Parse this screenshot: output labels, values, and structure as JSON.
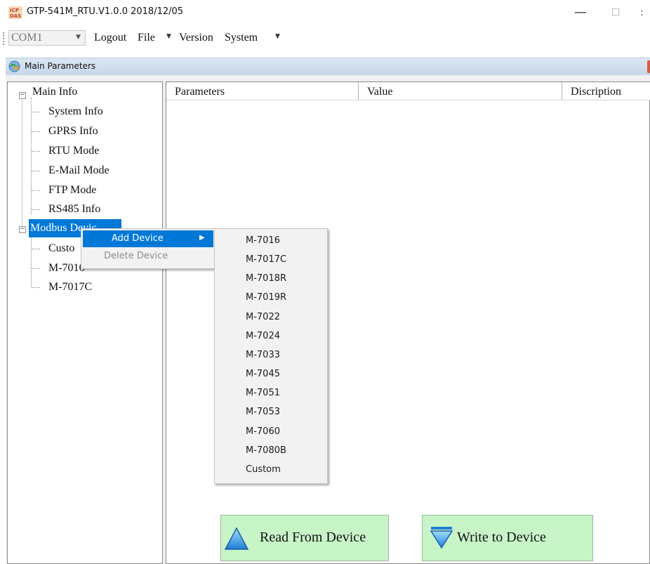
{
  "window": {
    "title": "GTP-541M_RTU.V1.0.0 2018/12/05"
  },
  "menubar": {
    "com_port": "COM1",
    "items": [
      {
        "label": "Logout",
        "has_dropdown": false
      },
      {
        "label": "File",
        "has_dropdown": true
      },
      {
        "label": "Version",
        "has_dropdown": false
      },
      {
        "label": "System",
        "has_dropdown": true
      }
    ]
  },
  "child_window": {
    "title": "Main Parameters"
  },
  "tree": {
    "main_info": {
      "label": "Main Info",
      "children": [
        "System Info",
        "GPRS Info",
        "RTU Mode",
        "E-Mail Mode",
        "FTP Mode",
        "RS485 Info"
      ]
    },
    "modbus_device": {
      "label": "Modbus Devic",
      "children": [
        "Custo",
        "M-7016",
        "M-7017C"
      ]
    }
  },
  "table": {
    "columns": [
      "Parameters",
      "Value",
      "Discription"
    ]
  },
  "context_menu": {
    "items": [
      {
        "label": "Add Device",
        "enabled": true,
        "highlighted": true,
        "has_submenu": true
      },
      {
        "label": "Delete Device",
        "enabled": false,
        "highlighted": false,
        "has_submenu": false
      }
    ]
  },
  "submenu": {
    "items": [
      "M-7016",
      "M-7017C",
      "M-7018R",
      "M-7019R",
      "M-7022",
      "M-7024",
      "M-7033",
      "M-7045",
      "M-7051",
      "M-7053",
      "M-7060",
      "M-7080B",
      "Custom"
    ]
  },
  "buttons": {
    "read": "Read From Device",
    "write": "Write to Device"
  },
  "colors": {
    "selection": "#0078d7",
    "button_bg": "#c8f5c8",
    "menu_bg": "#f2f2f2",
    "title_gradient": "#c5d6ea"
  }
}
